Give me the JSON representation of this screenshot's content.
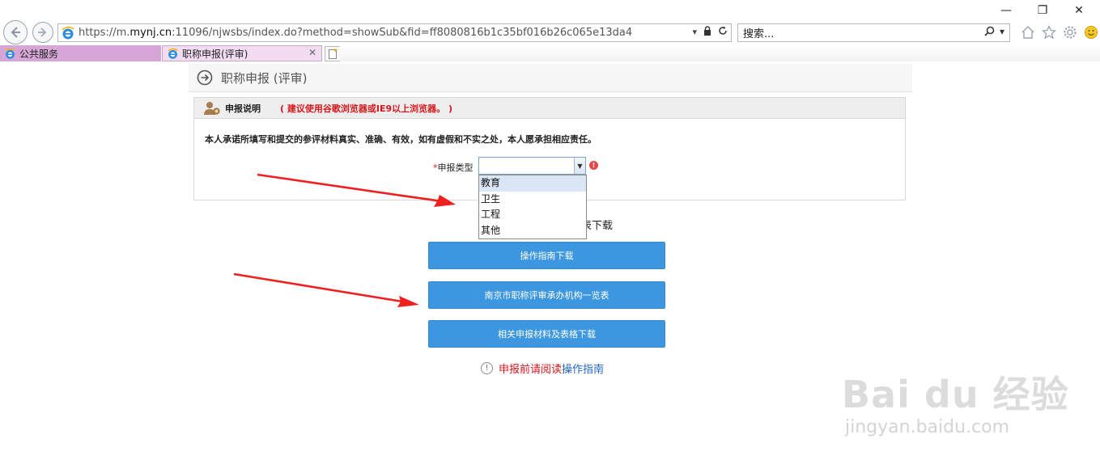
{
  "browser": {
    "window_buttons": {
      "minimize": "—",
      "maximize": "❐",
      "close": "✕"
    },
    "address": {
      "url_prefix": "https://m.",
      "url_domain": "mynj.cn",
      "url_rest": ":11096/njwsbs/index.do?method=showSub&fid=ff8080816b1c35bf016b26c065e13da4"
    },
    "search": {
      "placeholder": "搜索..."
    },
    "tabs": [
      {
        "label": "公共服务"
      },
      {
        "label": "职称申报(评审)",
        "close": "✕"
      }
    ]
  },
  "page": {
    "title": "职称申报 (评审)",
    "panel": {
      "heading": "申报说明",
      "note": "( 建议使用谷歌浏览器或IE9以上浏览器。 )",
      "promise": "本人承诺所填写和提交的参评材料真实、准确、有效，如有虚假和不实之处，本人愿承担相应责任。"
    },
    "form": {
      "required_mark": "*",
      "type_label": "申报类型",
      "type_value": "",
      "error_mark": "!",
      "options": [
        "教育",
        "卫生",
        "工程",
        "其他"
      ]
    },
    "download_text": "表下载",
    "buttons": {
      "guide": "操作指南下载",
      "agencies": "南京市职称评审承办机构一览表",
      "materials": "相关申报材料及表格下载"
    },
    "notice": {
      "icon": "!",
      "prefix": "申报前请阅读",
      "link": "操作指南"
    }
  },
  "watermark": {
    "main": "Bai du 经验",
    "sub": "jingyan.baidu.com"
  },
  "colors": {
    "button_blue": "#3c97e0",
    "alert_red": "#d8161c",
    "link_blue": "#2366c4",
    "active_tab": "#f2dcf2",
    "inactive_tab": "#d6a6d6",
    "annotation_arrow": "#f02020"
  }
}
